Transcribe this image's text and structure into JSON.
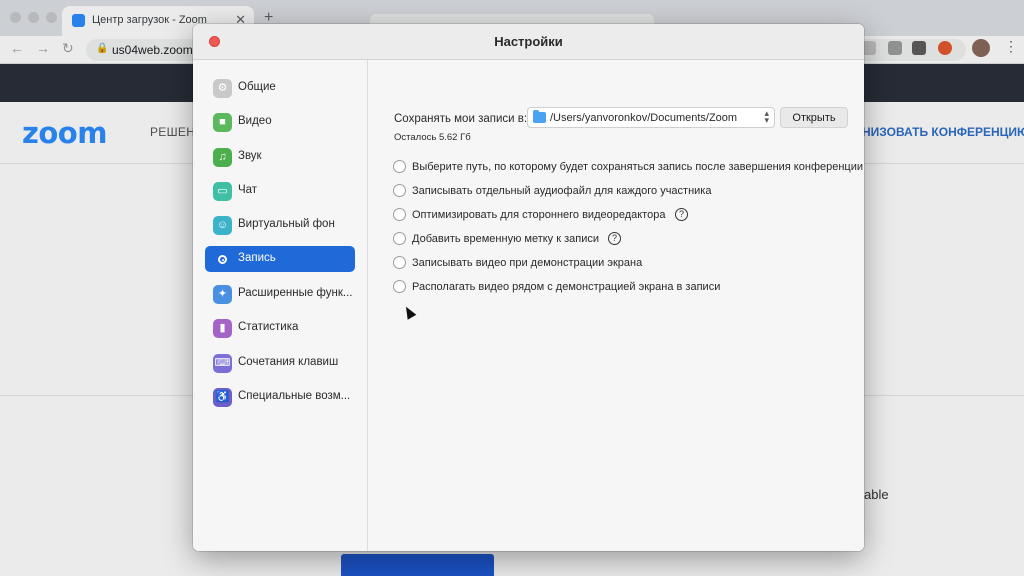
{
  "browser": {
    "tab_title": "Центр загрузок - Zoom",
    "tab_close": "✕",
    "new_tab": "+",
    "url": "us04web.zoom"
  },
  "site": {
    "logo": "zoom",
    "nav_left": "РЕШЕН",
    "nav_right": "НИЗОВАТЬ КОНФЕРЕНЦИЮ",
    "page_fragment": "able"
  },
  "window": {
    "title": "Настройки"
  },
  "sidebar": {
    "items": [
      {
        "label": "Общие",
        "icon": "gear-icon",
        "color": "#c9c9c9"
      },
      {
        "label": "Видео",
        "icon": "video-icon",
        "color": "#5cb85c"
      },
      {
        "label": "Звук",
        "icon": "headphones-icon",
        "color": "#4cae4c"
      },
      {
        "label": "Чат",
        "icon": "chat-icon",
        "color": "#3fbfa3"
      },
      {
        "label": "Виртуальный фон",
        "icon": "virtual-background-icon",
        "color": "#3bb3c9"
      },
      {
        "label": "Запись",
        "icon": "record-icon",
        "color": "#1f6ad8"
      },
      {
        "label": "Расширенные функ...",
        "icon": "advanced-features-icon",
        "color": "#4a90e2"
      },
      {
        "label": "Статистика",
        "icon": "statistics-icon",
        "color": "#a463c7"
      },
      {
        "label": "Сочетания клавиш",
        "icon": "keyboard-icon",
        "color": "#7b6fd6"
      },
      {
        "label": "Специальные возм...",
        "icon": "accessibility-icon",
        "color": "#6a5fc9"
      }
    ],
    "active_index": 5
  },
  "recording": {
    "save_label": "Сохранять мои записи в:",
    "path": "/Users/yanvoronkov/Documents/Zoom",
    "open_button": "Открыть",
    "remaining": "Осталось 5.62 Гб",
    "options": [
      {
        "label": "Выберите путь, по которому будет сохраняться запись после завершения конференции",
        "checked": false,
        "help": false
      },
      {
        "label": "Записывать отдельный аудиофайл для каждого участника",
        "checked": false,
        "help": false
      },
      {
        "label": "Оптимизировать для стороннего видеоредактора",
        "checked": false,
        "help": true
      },
      {
        "label": "Добавить временную метку к записи",
        "checked": false,
        "help": true
      },
      {
        "label": "Записывать видео при демонстрации экрана",
        "checked": false,
        "help": false
      },
      {
        "label": "Располагать видео рядом с демонстрацией экрана в записи",
        "checked": false,
        "help": false
      }
    ]
  },
  "colors": {
    "accent": "#1f6ad8",
    "close_button": "#ee5a52",
    "zoom_brand": "#2d8cff"
  }
}
